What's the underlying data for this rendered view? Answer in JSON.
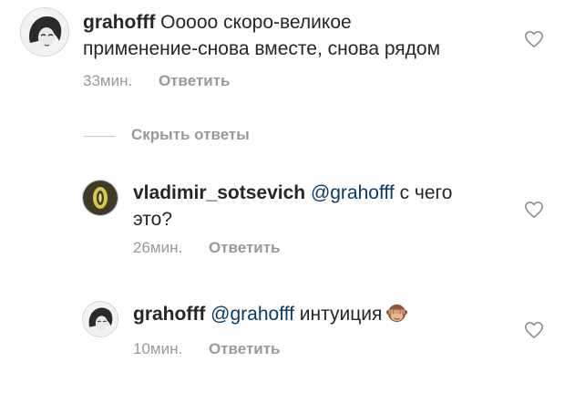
{
  "comments": [
    {
      "username": "grahofff",
      "mention": "",
      "text_line1": "Ооооо скоро-великое",
      "text_line2": "применение-снова вместе, снова рядом",
      "time": "33мин.",
      "reply_label": "Ответить"
    },
    {
      "username": "vladimir_sotsevich",
      "mention": "@grahofff",
      "text_line1": "с чего",
      "text_line2": "это?",
      "time": "26мин.",
      "reply_label": "Ответить"
    },
    {
      "username": "grahofff",
      "mention": "@grahofff",
      "text_line1": "интуиция",
      "emoji": "see-no-evil-monkey",
      "time": "10мин.",
      "reply_label": "Ответить"
    }
  ],
  "hide_replies_label": "Скрыть ответы",
  "icons": {
    "like": "heart-outline-icon"
  },
  "colors": {
    "text": "#262626",
    "muted": "#999999",
    "mention": "#0a3a6b",
    "divider": "#c7c7c7"
  }
}
